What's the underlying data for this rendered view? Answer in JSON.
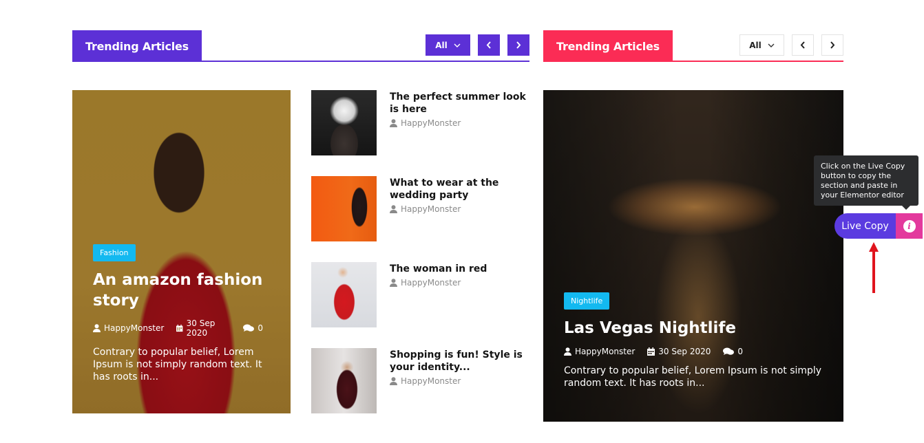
{
  "widget_left": {
    "header_title": "Trending Articles",
    "filter_label": "All",
    "accent": "#5c30d6",
    "featured": {
      "category": "Fashion",
      "title": "An amazon fashion story",
      "author": "HappyMonster",
      "date": "30 Sep 2020",
      "comments": "0",
      "excerpt": "Contrary to popular belief, Lorem Ipsum is not simply random text. It has roots in..."
    },
    "list": [
      {
        "title": "The perfect summer look is here",
        "author": "HappyMonster"
      },
      {
        "title": "What to wear at the wedding party",
        "author": "HappyMonster"
      },
      {
        "title": "The woman in red",
        "author": "HappyMonster"
      },
      {
        "title": "Shopping is fun! Style is your identity...",
        "author": "HappyMonster"
      }
    ]
  },
  "widget_right": {
    "header_title": "Trending Articles",
    "filter_label": "All",
    "accent": "#fb2c55",
    "featured": {
      "category": "Nightlife",
      "title": "Las Vegas Nightlife",
      "author": "HappyMonster",
      "date": "30 Sep 2020",
      "comments": "0",
      "excerpt": "Contrary to popular belief, Lorem Ipsum is not simply random text. It has roots in..."
    }
  },
  "live_copy": {
    "tooltip": "Click on the Live Copy button to copy the section and paste in your Elementor editor",
    "button_label": "Live Copy",
    "info_icon": "i",
    "button_color": "#5b3be0",
    "info_color": "#e3399d"
  },
  "icons": [
    "user-icon",
    "calendar-icon",
    "comments-icon",
    "chevron-left-icon",
    "chevron-right-icon",
    "chevron-down-icon",
    "info-icon",
    "arrow-up-icon"
  ]
}
